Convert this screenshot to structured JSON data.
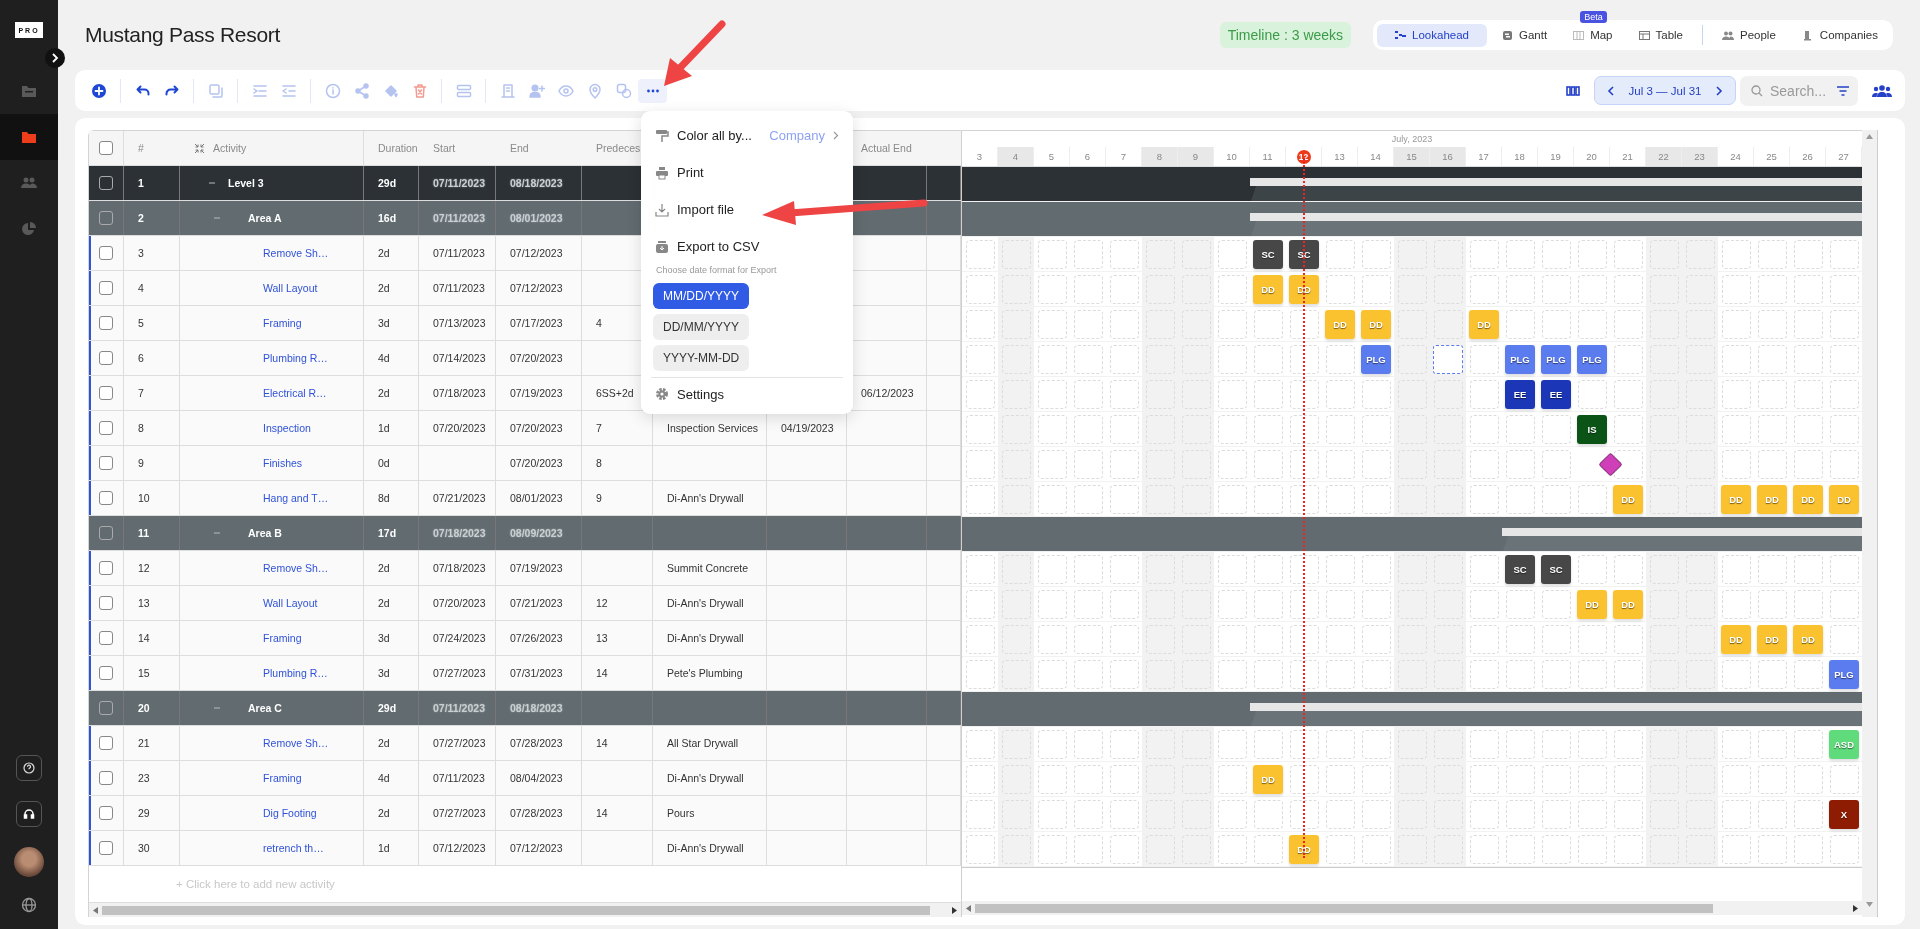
{
  "sidebar": {
    "logo": "PRO",
    "items": [
      {
        "kind": "files",
        "selected": false
      },
      {
        "kind": "folder",
        "selected": true
      },
      {
        "kind": "people",
        "selected": false
      },
      {
        "kind": "chart",
        "selected": false
      }
    ],
    "bottom": [
      {
        "kind": "help"
      },
      {
        "kind": "headset"
      },
      {
        "kind": "avatar"
      },
      {
        "kind": "globe"
      }
    ]
  },
  "title": "Mustang Pass Resort",
  "timeline": "Timeline : 3 weeks",
  "views": [
    {
      "label": "Lookahead",
      "kind": "lookahead",
      "selected": true
    },
    {
      "label": "Gantt",
      "kind": "gantt",
      "selected": false
    },
    {
      "label": "Map",
      "kind": "map",
      "selected": false,
      "badge": "Beta"
    },
    {
      "label": "Table",
      "kind": "table",
      "selected": false
    }
  ],
  "panels": [
    {
      "label": "People",
      "kind": "people"
    },
    {
      "label": "Companies",
      "kind": "companies"
    }
  ],
  "toolbar": {
    "tools": [
      {
        "kind": "add",
        "disabled": false
      },
      {
        "kind": "sep"
      },
      {
        "kind": "undo",
        "disabled": false
      },
      {
        "kind": "redo",
        "disabled": false
      },
      {
        "kind": "sep"
      },
      {
        "kind": "copy",
        "disabled": true
      },
      {
        "kind": "sep"
      },
      {
        "kind": "indent",
        "disabled": true
      },
      {
        "kind": "outdent",
        "disabled": true
      },
      {
        "kind": "sep"
      },
      {
        "kind": "info",
        "disabled": true
      },
      {
        "kind": "share",
        "disabled": true
      },
      {
        "kind": "fill",
        "disabled": true
      },
      {
        "kind": "delete",
        "disabled": true
      },
      {
        "kind": "sep"
      },
      {
        "kind": "schedule",
        "disabled": true
      },
      {
        "kind": "sep"
      },
      {
        "kind": "building",
        "disabled": true
      },
      {
        "kind": "assign",
        "disabled": true
      },
      {
        "kind": "eye",
        "disabled": true
      },
      {
        "kind": "pin",
        "disabled": true
      },
      {
        "kind": "link",
        "disabled": true
      },
      {
        "kind": "more",
        "disabled": false
      }
    ],
    "date_range": "Jul 3 — Jul 31",
    "search": {
      "placeholder": "Search..."
    }
  },
  "menu": {
    "open": true,
    "items": [
      {
        "kind": "color",
        "label": "Color all by...",
        "value": "Company"
      },
      {
        "kind": "print",
        "label": "Print"
      },
      {
        "kind": "import",
        "label": "Import file"
      },
      {
        "kind": "export",
        "label": "Export to CSV"
      }
    ],
    "caption": "Choose date format for Export",
    "formats": [
      {
        "label": "MM/DD/YYYY",
        "selected": true
      },
      {
        "label": "DD/MM/YYYY",
        "selected": false
      },
      {
        "label": "YYYY-MM-DD",
        "selected": false
      }
    ],
    "settings": "Settings"
  },
  "table": {
    "header_checked": false,
    "columns": [
      {
        "label": "#"
      },
      {
        "label": "Activity"
      },
      {
        "label": "Duration"
      },
      {
        "label": "Start"
      },
      {
        "label": "End"
      },
      {
        "label": "Predeces"
      },
      {},
      {},
      {
        "label": "Actual End"
      },
      {}
    ],
    "rows": [
      {
        "kind": "level",
        "checked": false,
        "expanded": true,
        "num": "1",
        "activity": "Level 3",
        "duration": "29d",
        "start": "07/11/2023",
        "end": "08/18/2023"
      },
      {
        "kind": "area",
        "checked": false,
        "expanded": true,
        "num": "2",
        "activity": "Area A",
        "duration": "16d",
        "start": "07/11/2023",
        "end": "08/01/2023"
      },
      {
        "kind": "task",
        "checked": false,
        "num": "3",
        "activity": "Remove Sh…",
        "duration": "2d",
        "start": "07/11/2023",
        "end": "07/12/2023",
        "cells": [
          {
            "kind": "slot"
          },
          {
            "kind": "slot"
          },
          {
            "kind": "slot"
          },
          {
            "kind": "slot"
          },
          {
            "kind": "slot"
          },
          {
            "kind": "slot"
          },
          {
            "kind": "slot"
          },
          {
            "kind": "slot"
          },
          {
            "kind": "tile",
            "label": "SC",
            "color": "#474747"
          },
          {
            "kind": "tile",
            "label": "SC",
            "color": "#474747"
          },
          {
            "kind": "slot"
          },
          {
            "kind": "slot"
          },
          {
            "kind": "slot"
          },
          {
            "kind": "slot"
          },
          {
            "kind": "slot"
          },
          {
            "kind": "slot"
          },
          {
            "kind": "slot"
          },
          {
            "kind": "slot"
          },
          {
            "kind": "slot"
          },
          {
            "kind": "slot"
          },
          {
            "kind": "slot"
          },
          {
            "kind": "slot"
          },
          {
            "kind": "slot"
          },
          {
            "kind": "slot"
          },
          {
            "kind": "slot"
          }
        ]
      },
      {
        "kind": "task",
        "checked": false,
        "num": "4",
        "activity": "Wall Layout",
        "duration": "2d",
        "start": "07/11/2023",
        "end": "07/12/2023",
        "cells": [
          {
            "kind": "slot"
          },
          {
            "kind": "slot"
          },
          {
            "kind": "slot"
          },
          {
            "kind": "slot"
          },
          {
            "kind": "slot"
          },
          {
            "kind": "slot"
          },
          {
            "kind": "slot"
          },
          {
            "kind": "slot"
          },
          {
            "kind": "tile",
            "label": "DD",
            "color": "#fbc22f"
          },
          {
            "kind": "tile",
            "label": "DD",
            "color": "#fbc22f"
          },
          {
            "kind": "slot"
          },
          {
            "kind": "slot"
          },
          {
            "kind": "slot"
          },
          {
            "kind": "slot"
          },
          {
            "kind": "slot"
          },
          {
            "kind": "slot"
          },
          {
            "kind": "slot"
          },
          {
            "kind": "slot"
          },
          {
            "kind": "slot"
          },
          {
            "kind": "slot"
          },
          {
            "kind": "slot"
          },
          {
            "kind": "slot"
          },
          {
            "kind": "slot"
          },
          {
            "kind": "slot"
          },
          {
            "kind": "slot"
          }
        ]
      },
      {
        "kind": "task",
        "checked": false,
        "num": "5",
        "activity": "Framing",
        "duration": "3d",
        "start": "07/13/2023",
        "end": "07/17/2023",
        "column_6": "4",
        "cells": [
          {
            "kind": "slot"
          },
          {
            "kind": "slot"
          },
          {
            "kind": "slot"
          },
          {
            "kind": "slot"
          },
          {
            "kind": "slot"
          },
          {
            "kind": "slot"
          },
          {
            "kind": "slot"
          },
          {
            "kind": "slot"
          },
          {
            "kind": "slot"
          },
          {
            "kind": "slot"
          },
          {
            "kind": "tile",
            "label": "DD",
            "color": "#fbc22f"
          },
          {
            "kind": "tile",
            "label": "DD",
            "color": "#fbc22f"
          },
          {
            "kind": "slot"
          },
          {
            "kind": "slot"
          },
          {
            "kind": "tile",
            "label": "DD",
            "color": "#fbc22f"
          },
          {
            "kind": "slot"
          },
          {
            "kind": "slot"
          },
          {
            "kind": "slot"
          },
          {
            "kind": "slot"
          },
          {
            "kind": "slot"
          },
          {
            "kind": "slot"
          },
          {
            "kind": "slot"
          },
          {
            "kind": "slot"
          },
          {
            "kind": "slot"
          },
          {
            "kind": "slot"
          }
        ]
      },
      {
        "kind": "task",
        "checked": false,
        "num": "6",
        "activity": "Plumbing R…",
        "duration": "4d",
        "start": "07/14/2023",
        "end": "07/20/2023",
        "cells": [
          {
            "kind": "slot"
          },
          {
            "kind": "slot"
          },
          {
            "kind": "slot"
          },
          {
            "kind": "slot"
          },
          {
            "kind": "slot"
          },
          {
            "kind": "slot"
          },
          {
            "kind": "slot"
          },
          {
            "kind": "slot"
          },
          {
            "kind": "slot"
          },
          {
            "kind": "slot"
          },
          {
            "kind": "slot"
          },
          {
            "kind": "tile",
            "label": "PLG",
            "color": "#5b7cef"
          },
          {
            "kind": "slot"
          },
          {
            "kind": "ghost"
          },
          {
            "kind": "slot"
          },
          {
            "kind": "tile",
            "label": "PLG",
            "color": "#5b7cef"
          },
          {
            "kind": "tile",
            "label": "PLG",
            "color": "#5b7cef"
          },
          {
            "kind": "tile",
            "label": "PLG",
            "color": "#5b7cef"
          },
          {
            "kind": "slot"
          },
          {
            "kind": "slot"
          },
          {
            "kind": "slot"
          },
          {
            "kind": "slot"
          },
          {
            "kind": "slot"
          },
          {
            "kind": "slot"
          },
          {
            "kind": "slot"
          }
        ]
      },
      {
        "kind": "task",
        "checked": false,
        "num": "7",
        "activity": "Electrical R…",
        "duration": "2d",
        "start": "07/18/2023",
        "end": "07/19/2023",
        "column_6": "6SS+2d",
        "actual_end": "06/12/2023",
        "cells": [
          {
            "kind": "slot"
          },
          {
            "kind": "slot"
          },
          {
            "kind": "slot"
          },
          {
            "kind": "slot"
          },
          {
            "kind": "slot"
          },
          {
            "kind": "slot"
          },
          {
            "kind": "slot"
          },
          {
            "kind": "slot"
          },
          {
            "kind": "slot"
          },
          {
            "kind": "slot"
          },
          {
            "kind": "slot"
          },
          {
            "kind": "slot"
          },
          {
            "kind": "slot"
          },
          {
            "kind": "slot"
          },
          {
            "kind": "slot"
          },
          {
            "kind": "tile",
            "label": "EE",
            "color": "#1b37b7"
          },
          {
            "kind": "tile",
            "label": "EE",
            "color": "#1b37b7"
          },
          {
            "kind": "slot"
          },
          {
            "kind": "slot"
          },
          {
            "kind": "slot"
          },
          {
            "kind": "slot"
          },
          {
            "kind": "slot"
          },
          {
            "kind": "slot"
          },
          {
            "kind": "slot"
          },
          {
            "kind": "slot"
          }
        ]
      },
      {
        "kind": "task",
        "checked": false,
        "num": "8",
        "activity": "Inspection",
        "duration": "1d",
        "start": "07/20/2023",
        "end": "07/20/2023",
        "column_6": "7",
        "column_7": "Inspection Services",
        "column_8": "04/19/2023",
        "cells": [
          {
            "kind": "slot"
          },
          {
            "kind": "slot"
          },
          {
            "kind": "slot"
          },
          {
            "kind": "slot"
          },
          {
            "kind": "slot"
          },
          {
            "kind": "slot"
          },
          {
            "kind": "slot"
          },
          {
            "kind": "slot"
          },
          {
            "kind": "slot"
          },
          {
            "kind": "slot"
          },
          {
            "kind": "slot"
          },
          {
            "kind": "slot"
          },
          {
            "kind": "slot"
          },
          {
            "kind": "slot"
          },
          {
            "kind": "slot"
          },
          {
            "kind": "slot"
          },
          {
            "kind": "slot"
          },
          {
            "kind": "tile",
            "label": "IS",
            "color": "#0b5317"
          },
          {
            "kind": "slot"
          },
          {
            "kind": "slot"
          },
          {
            "kind": "slot"
          },
          {
            "kind": "slot"
          },
          {
            "kind": "slot"
          },
          {
            "kind": "slot"
          },
          {
            "kind": "slot"
          }
        ]
      },
      {
        "kind": "task",
        "checked": false,
        "num": "9",
        "activity": "Finishes",
        "duration": "0d",
        "end": "07/20/2023",
        "column_6": "8",
        "cells": [
          {
            "kind": "slot"
          },
          {
            "kind": "slot"
          },
          {
            "kind": "slot"
          },
          {
            "kind": "slot"
          },
          {
            "kind": "slot"
          },
          {
            "kind": "slot"
          },
          {
            "kind": "slot"
          },
          {
            "kind": "slot"
          },
          {
            "kind": "slot"
          },
          {
            "kind": "slot"
          },
          {
            "kind": "slot"
          },
          {
            "kind": "slot"
          },
          {
            "kind": "slot"
          },
          {
            "kind": "slot"
          },
          {
            "kind": "slot"
          },
          {
            "kind": "slot"
          },
          {
            "kind": "slot"
          },
          {
            "kind": "milestone",
            "color": "#cf3fb8"
          },
          {
            "kind": "slot"
          },
          {
            "kind": "slot"
          },
          {
            "kind": "slot"
          },
          {
            "kind": "slot"
          },
          {
            "kind": "slot"
          },
          {
            "kind": "slot"
          },
          {
            "kind": "slot"
          }
        ]
      },
      {
        "kind": "task",
        "checked": false,
        "num": "10",
        "activity": "Hang and T…",
        "duration": "8d",
        "start": "07/21/2023",
        "end": "08/01/2023",
        "column_6": "9",
        "column_7": "Di-Ann's Drywall",
        "cells": [
          {
            "kind": "slot"
          },
          {
            "kind": "slot"
          },
          {
            "kind": "slot"
          },
          {
            "kind": "slot"
          },
          {
            "kind": "slot"
          },
          {
            "kind": "slot"
          },
          {
            "kind": "slot"
          },
          {
            "kind": "slot"
          },
          {
            "kind": "slot"
          },
          {
            "kind": "slot"
          },
          {
            "kind": "slot"
          },
          {
            "kind": "slot"
          },
          {
            "kind": "slot"
          },
          {
            "kind": "slot"
          },
          {
            "kind": "slot"
          },
          {
            "kind": "slot"
          },
          {
            "kind": "slot"
          },
          {
            "kind": "slot"
          },
          {
            "kind": "tile",
            "label": "DD",
            "color": "#fbc22f"
          },
          {
            "kind": "slot"
          },
          {
            "kind": "slot"
          },
          {
            "kind": "tile",
            "label": "DD",
            "color": "#fbc22f"
          },
          {
            "kind": "tile",
            "label": "DD",
            "color": "#fbc22f"
          },
          {
            "kind": "tile",
            "label": "DD",
            "color": "#fbc22f"
          },
          {
            "kind": "tile",
            "label": "DD",
            "color": "#fbc22f"
          }
        ]
      },
      {
        "kind": "area",
        "checked": false,
        "expanded": true,
        "num": "11",
        "activity": "Area B",
        "duration": "17d",
        "start": "07/18/2023",
        "end": "08/09/2023"
      },
      {
        "kind": "task",
        "checked": false,
        "num": "12",
        "activity": "Remove Sh…",
        "duration": "2d",
        "start": "07/18/2023",
        "end": "07/19/2023",
        "column_7": "Summit Concrete",
        "cells": [
          {
            "kind": "slot"
          },
          {
            "kind": "slot"
          },
          {
            "kind": "slot"
          },
          {
            "kind": "slot"
          },
          {
            "kind": "slot"
          },
          {
            "kind": "slot"
          },
          {
            "kind": "slot"
          },
          {
            "kind": "slot"
          },
          {
            "kind": "slot"
          },
          {
            "kind": "slot"
          },
          {
            "kind": "slot"
          },
          {
            "kind": "slot"
          },
          {
            "kind": "slot"
          },
          {
            "kind": "slot"
          },
          {
            "kind": "slot"
          },
          {
            "kind": "tile",
            "label": "SC",
            "color": "#474747"
          },
          {
            "kind": "tile",
            "label": "SC",
            "color": "#474747"
          },
          {
            "kind": "slot"
          },
          {
            "kind": "slot"
          },
          {
            "kind": "slot"
          },
          {
            "kind": "slot"
          },
          {
            "kind": "slot"
          },
          {
            "kind": "slot"
          },
          {
            "kind": "slot"
          },
          {
            "kind": "slot"
          }
        ]
      },
      {
        "kind": "task",
        "checked": false,
        "num": "13",
        "activity": "Wall Layout",
        "duration": "2d",
        "start": "07/20/2023",
        "end": "07/21/2023",
        "column_6": "12",
        "column_7": "Di-Ann's Drywall",
        "cells": [
          {
            "kind": "slot"
          },
          {
            "kind": "slot"
          },
          {
            "kind": "slot"
          },
          {
            "kind": "slot"
          },
          {
            "kind": "slot"
          },
          {
            "kind": "slot"
          },
          {
            "kind": "slot"
          },
          {
            "kind": "slot"
          },
          {
            "kind": "slot"
          },
          {
            "kind": "slot"
          },
          {
            "kind": "slot"
          },
          {
            "kind": "slot"
          },
          {
            "kind": "slot"
          },
          {
            "kind": "slot"
          },
          {
            "kind": "slot"
          },
          {
            "kind": "slot"
          },
          {
            "kind": "slot"
          },
          {
            "kind": "tile",
            "label": "DD",
            "color": "#fbc22f"
          },
          {
            "kind": "tile",
            "label": "DD",
            "color": "#fbc22f"
          },
          {
            "kind": "slot"
          },
          {
            "kind": "slot"
          },
          {
            "kind": "slot"
          },
          {
            "kind": "slot"
          },
          {
            "kind": "slot"
          },
          {
            "kind": "slot"
          }
        ]
      },
      {
        "kind": "task",
        "checked": false,
        "num": "14",
        "activity": "Framing",
        "duration": "3d",
        "start": "07/24/2023",
        "end": "07/26/2023",
        "column_6": "13",
        "column_7": "Di-Ann's Drywall",
        "cells": [
          {
            "kind": "slot"
          },
          {
            "kind": "slot"
          },
          {
            "kind": "slot"
          },
          {
            "kind": "slot"
          },
          {
            "kind": "slot"
          },
          {
            "kind": "slot"
          },
          {
            "kind": "slot"
          },
          {
            "kind": "slot"
          },
          {
            "kind": "slot"
          },
          {
            "kind": "slot"
          },
          {
            "kind": "slot"
          },
          {
            "kind": "slot"
          },
          {
            "kind": "slot"
          },
          {
            "kind": "slot"
          },
          {
            "kind": "slot"
          },
          {
            "kind": "slot"
          },
          {
            "kind": "slot"
          },
          {
            "kind": "slot"
          },
          {
            "kind": "slot"
          },
          {
            "kind": "slot"
          },
          {
            "kind": "slot"
          },
          {
            "kind": "tile",
            "label": "DD",
            "color": "#fbc22f"
          },
          {
            "kind": "tile",
            "label": "DD",
            "color": "#fbc22f"
          },
          {
            "kind": "tile",
            "label": "DD",
            "color": "#fbc22f"
          },
          {
            "kind": "slot"
          }
        ]
      },
      {
        "kind": "task",
        "checked": false,
        "num": "15",
        "activity": "Plumbing R…",
        "duration": "3d",
        "start": "07/27/2023",
        "end": "07/31/2023",
        "column_6": "14",
        "column_7": "Pete's Plumbing",
        "cells": [
          {
            "kind": "slot"
          },
          {
            "kind": "slot"
          },
          {
            "kind": "slot"
          },
          {
            "kind": "slot"
          },
          {
            "kind": "slot"
          },
          {
            "kind": "slot"
          },
          {
            "kind": "slot"
          },
          {
            "kind": "slot"
          },
          {
            "kind": "slot"
          },
          {
            "kind": "slot"
          },
          {
            "kind": "slot"
          },
          {
            "kind": "slot"
          },
          {
            "kind": "slot"
          },
          {
            "kind": "slot"
          },
          {
            "kind": "slot"
          },
          {
            "kind": "slot"
          },
          {
            "kind": "slot"
          },
          {
            "kind": "slot"
          },
          {
            "kind": "slot"
          },
          {
            "kind": "slot"
          },
          {
            "kind": "slot"
          },
          {
            "kind": "slot"
          },
          {
            "kind": "slot"
          },
          {
            "kind": "slot"
          },
          {
            "kind": "tile",
            "label": "PLG",
            "color": "#5b7cef"
          }
        ]
      },
      {
        "kind": "area",
        "checked": false,
        "expanded": true,
        "num": "20",
        "activity": "Area C",
        "duration": "29d",
        "start": "07/11/2023",
        "end": "08/18/2023"
      },
      {
        "kind": "task",
        "checked": false,
        "num": "21",
        "activity": "Remove Sh…",
        "duration": "2d",
        "start": "07/27/2023",
        "end": "07/28/2023",
        "column_6": "14",
        "column_7": "All Star Drywall",
        "cells": [
          {
            "kind": "slot"
          },
          {
            "kind": "slot"
          },
          {
            "kind": "slot"
          },
          {
            "kind": "slot"
          },
          {
            "kind": "slot"
          },
          {
            "kind": "slot"
          },
          {
            "kind": "slot"
          },
          {
            "kind": "slot"
          },
          {
            "kind": "slot"
          },
          {
            "kind": "slot"
          },
          {
            "kind": "slot"
          },
          {
            "kind": "slot"
          },
          {
            "kind": "slot"
          },
          {
            "kind": "slot"
          },
          {
            "kind": "slot"
          },
          {
            "kind": "slot"
          },
          {
            "kind": "slot"
          },
          {
            "kind": "slot"
          },
          {
            "kind": "slot"
          },
          {
            "kind": "slot"
          },
          {
            "kind": "slot"
          },
          {
            "kind": "slot"
          },
          {
            "kind": "slot"
          },
          {
            "kind": "slot"
          },
          {
            "kind": "tile",
            "label": "ASD",
            "color": "#5fdb7c"
          }
        ]
      },
      {
        "kind": "task",
        "checked": false,
        "num": "23",
        "activity": "Framing",
        "duration": "4d",
        "start": "07/11/2023",
        "end": "08/04/2023",
        "column_7": "Di-Ann's Drywall",
        "cells": [
          {
            "kind": "slot"
          },
          {
            "kind": "slot"
          },
          {
            "kind": "slot"
          },
          {
            "kind": "slot"
          },
          {
            "kind": "slot"
          },
          {
            "kind": "slot"
          },
          {
            "kind": "slot"
          },
          {
            "kind": "slot"
          },
          {
            "kind": "tile",
            "label": "DD",
            "color": "#fbc22f"
          },
          {
            "kind": "slot"
          },
          {
            "kind": "slot"
          },
          {
            "kind": "slot"
          },
          {
            "kind": "slot"
          },
          {
            "kind": "slot"
          },
          {
            "kind": "slot"
          },
          {
            "kind": "slot"
          },
          {
            "kind": "slot"
          },
          {
            "kind": "slot"
          },
          {
            "kind": "slot"
          },
          {
            "kind": "slot"
          },
          {
            "kind": "slot"
          },
          {
            "kind": "slot"
          },
          {
            "kind": "slot"
          },
          {
            "kind": "slot"
          },
          {
            "kind": "slot"
          }
        ]
      },
      {
        "kind": "task",
        "checked": false,
        "num": "29",
        "activity": "Dig Footing",
        "duration": "2d",
        "start": "07/27/2023",
        "end": "07/28/2023",
        "column_6": "14",
        "column_7": "Pours",
        "cells": [
          {
            "kind": "slot"
          },
          {
            "kind": "slot"
          },
          {
            "kind": "slot"
          },
          {
            "kind": "slot"
          },
          {
            "kind": "slot"
          },
          {
            "kind": "slot"
          },
          {
            "kind": "slot"
          },
          {
            "kind": "slot"
          },
          {
            "kind": "slot"
          },
          {
            "kind": "slot"
          },
          {
            "kind": "slot"
          },
          {
            "kind": "slot"
          },
          {
            "kind": "slot"
          },
          {
            "kind": "slot"
          },
          {
            "kind": "slot"
          },
          {
            "kind": "slot"
          },
          {
            "kind": "slot"
          },
          {
            "kind": "slot"
          },
          {
            "kind": "slot"
          },
          {
            "kind": "slot"
          },
          {
            "kind": "slot"
          },
          {
            "kind": "slot"
          },
          {
            "kind": "slot"
          },
          {
            "kind": "slot"
          },
          {
            "kind": "tile",
            "label": "X",
            "color": "#8d1c03"
          }
        ]
      },
      {
        "kind": "task",
        "checked": false,
        "num": "30",
        "activity": "retrench th…",
        "duration": "1d",
        "start": "07/12/2023",
        "end": "07/12/2023",
        "column_7": "Di-Ann's Drywall",
        "cells": [
          {
            "kind": "slot"
          },
          {
            "kind": "slot"
          },
          {
            "kind": "slot"
          },
          {
            "kind": "slot"
          },
          {
            "kind": "slot"
          },
          {
            "kind": "slot"
          },
          {
            "kind": "slot"
          },
          {
            "kind": "slot"
          },
          {
            "kind": "slot"
          },
          {
            "kind": "tile",
            "label": "DD",
            "color": "#fbc22f"
          },
          {
            "kind": "slot"
          },
          {
            "kind": "slot"
          },
          {
            "kind": "slot"
          },
          {
            "kind": "slot"
          },
          {
            "kind": "slot"
          },
          {
            "kind": "slot"
          },
          {
            "kind": "slot"
          },
          {
            "kind": "slot"
          },
          {
            "kind": "slot"
          },
          {
            "kind": "slot"
          },
          {
            "kind": "slot"
          },
          {
            "kind": "slot"
          },
          {
            "kind": "slot"
          },
          {
            "kind": "slot"
          },
          {
            "kind": "slot"
          }
        ]
      }
    ],
    "add_row": "+ Click here to add new activity"
  },
  "gantt": {
    "month": "July, 2023",
    "days": [
      {
        "label": "3",
        "shaded": false,
        "today": false
      },
      {
        "label": "4",
        "shaded": true,
        "today": false
      },
      {
        "label": "5",
        "shaded": false,
        "today": false
      },
      {
        "label": "6",
        "shaded": false,
        "today": false
      },
      {
        "label": "7",
        "shaded": false,
        "today": false
      },
      {
        "label": "8",
        "shaded": true,
        "today": false
      },
      {
        "label": "9",
        "shaded": true,
        "today": false
      },
      {
        "label": "10",
        "shaded": false,
        "today": false
      },
      {
        "label": "11",
        "shaded": false,
        "today": false
      },
      {
        "label": "12",
        "shaded": false,
        "today": true
      },
      {
        "label": "13",
        "shaded": false,
        "today": false
      },
      {
        "label": "14",
        "shaded": false,
        "today": false
      },
      {
        "label": "15",
        "shaded": true,
        "today": false
      },
      {
        "label": "16",
        "shaded": true,
        "today": false
      },
      {
        "label": "17",
        "shaded": false,
        "today": false
      },
      {
        "label": "18",
        "shaded": false,
        "today": false
      },
      {
        "label": "19",
        "shaded": false,
        "today": false
      },
      {
        "label": "20",
        "shaded": false,
        "today": false
      },
      {
        "label": "21",
        "shaded": false,
        "today": false
      },
      {
        "label": "22",
        "shaded": true,
        "today": false
      },
      {
        "label": "23",
        "shaded": true,
        "today": false
      },
      {
        "label": "24",
        "shaded": false,
        "today": false
      },
      {
        "label": "25",
        "shaded": false,
        "today": false
      },
      {
        "label": "26",
        "shaded": false,
        "today": false
      },
      {
        "label": "27",
        "shaded": false,
        "today": false
      }
    ]
  }
}
